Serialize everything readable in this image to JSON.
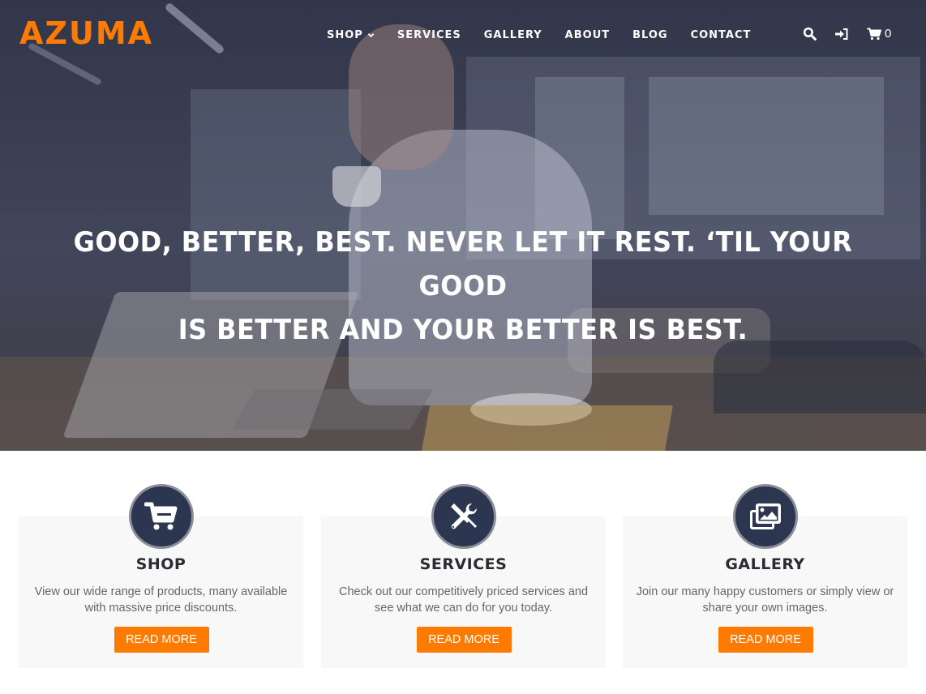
{
  "brand": {
    "logo": "AZUMA",
    "accent_color": "#ff7b00",
    "icon_circle_color": "#2d3650"
  },
  "nav": {
    "items": [
      {
        "label": "SHOP",
        "has_dropdown": true
      },
      {
        "label": "SERVICES",
        "has_dropdown": false
      },
      {
        "label": "GALLERY",
        "has_dropdown": false
      },
      {
        "label": "ABOUT",
        "has_dropdown": false
      },
      {
        "label": "BLOG",
        "has_dropdown": false
      },
      {
        "label": "CONTACT",
        "has_dropdown": false
      }
    ],
    "icons": [
      "search-icon",
      "sign-in-icon",
      "cart-icon"
    ],
    "cart_count": "0"
  },
  "hero": {
    "headline_line1": "GOOD, BETTER, BEST. NEVER LET IT REST. ‘TIL YOUR GOOD",
    "headline_line2": "IS BETTER AND YOUR BETTER IS BEST."
  },
  "cards": [
    {
      "icon": "cart-icon",
      "title": "SHOP",
      "desc_line1": "View our wide range of products, many available",
      "desc_line2": "with massive price discounts.",
      "button": "READ MORE"
    },
    {
      "icon": "tools-icon",
      "title": "SERVICES",
      "desc_line1": "Check out our competitively priced services and",
      "desc_line2": "see what we can do for you today.",
      "button": "READ MORE"
    },
    {
      "icon": "images-icon",
      "title": "GALLERY",
      "desc_line1": "Join our many happy customers or simply view or",
      "desc_line2": "share your own images.",
      "button": "READ MORE"
    }
  ]
}
